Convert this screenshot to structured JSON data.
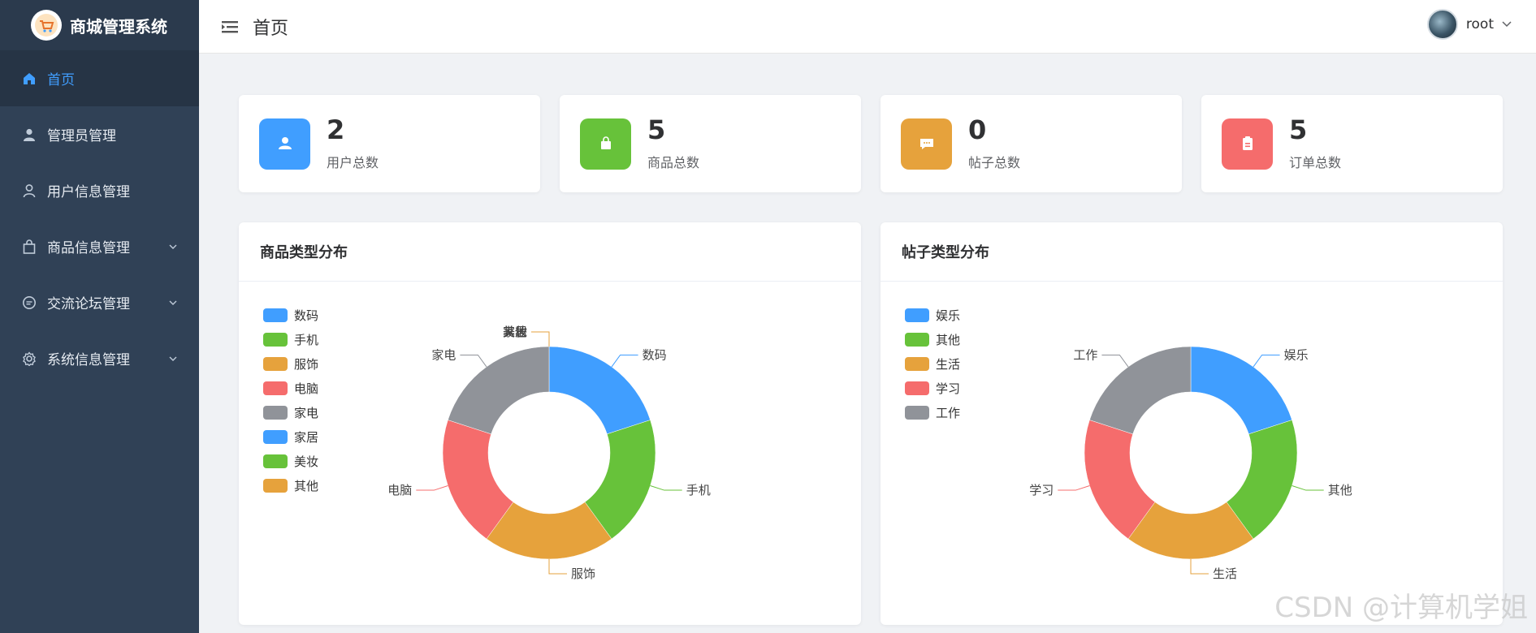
{
  "brand": {
    "title": "商城管理系统"
  },
  "sidebar": {
    "items": [
      {
        "label": "首页",
        "icon": "home-icon",
        "active": true,
        "expandable": false
      },
      {
        "label": "管理员管理",
        "icon": "user-filled-icon",
        "active": false,
        "expandable": false
      },
      {
        "label": "用户信息管理",
        "icon": "user-outline-icon",
        "active": false,
        "expandable": false
      },
      {
        "label": "商品信息管理",
        "icon": "shopping-bag-icon",
        "active": false,
        "expandable": true
      },
      {
        "label": "交流论坛管理",
        "icon": "chat-icon",
        "active": false,
        "expandable": true
      },
      {
        "label": "系统信息管理",
        "icon": "gear-icon",
        "active": false,
        "expandable": true
      }
    ]
  },
  "header": {
    "title": "首页",
    "username": "root"
  },
  "stats": [
    {
      "value": "2",
      "label": "用户总数",
      "color": "#409eff",
      "icon": "user-icon"
    },
    {
      "value": "5",
      "label": "商品总数",
      "color": "#67c23a",
      "icon": "shopping-bag-icon"
    },
    {
      "value": "0",
      "label": "帖子总数",
      "color": "#e6a23c",
      "icon": "chat-icon"
    },
    {
      "value": "5",
      "label": "订单总数",
      "color": "#f56c6c",
      "icon": "clipboard-icon"
    }
  ],
  "palette": [
    "#409eff",
    "#67c23a",
    "#e6a23c",
    "#f56c6c",
    "#909399"
  ],
  "chart_data": [
    {
      "type": "pie",
      "title": "商品类型分布",
      "legend_position": "top-left",
      "donut": true,
      "categories": [
        "数码",
        "手机",
        "服饰",
        "电脑",
        "家电",
        "家居",
        "美妆",
        "其他"
      ],
      "values": [
        1,
        1,
        1,
        1,
        1,
        0,
        0,
        0
      ],
      "colors": [
        "#409eff",
        "#67c23a",
        "#e6a23c",
        "#f56c6c",
        "#909399",
        "#409eff",
        "#67c23a",
        "#e6a23c"
      ]
    },
    {
      "type": "pie",
      "title": "帖子类型分布",
      "legend_position": "top-left",
      "donut": true,
      "categories": [
        "娱乐",
        "其他",
        "生活",
        "学习",
        "工作"
      ],
      "values": [
        1,
        1,
        1,
        1,
        1
      ],
      "colors": [
        "#409eff",
        "#67c23a",
        "#e6a23c",
        "#f56c6c",
        "#909399"
      ]
    }
  ],
  "watermark": "CSDN @计算机学姐"
}
